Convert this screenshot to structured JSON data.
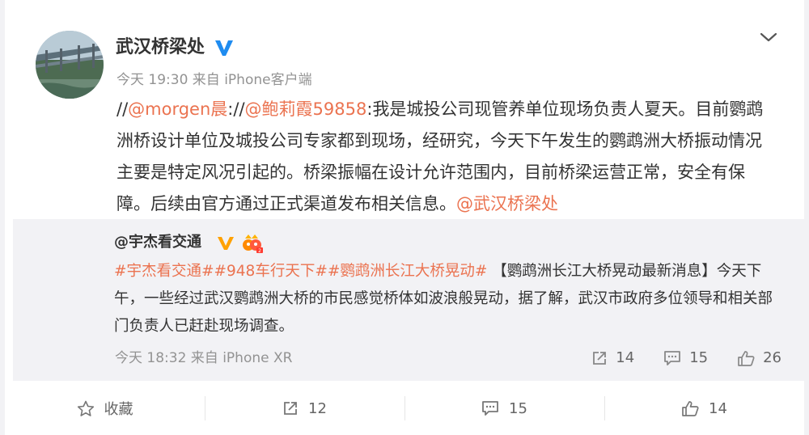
{
  "post": {
    "user_name": "武汉桥梁处",
    "meta": "今天 19:30 来自 iPhone客户端",
    "text": {
      "prefix1": "//",
      "mention1": "@morgen晨",
      "sep": "://",
      "mention2": "@鲍莉霞59858",
      "body": ":我是城投公司现管养单位现场负责人夏天。目前鹦鹉洲桥设计单位及城投公司专家都到现场，经研究，今天下午发生的鹦鹉洲大桥振动情况主要是特定风况引起的。桥梁振幅在设计允许范围内，目前桥梁运营正常，安全有保障。后续由官方通过正式渠道发布相关信息。",
      "mention3": "@武汉桥梁处"
    }
  },
  "repost": {
    "user": "@宇杰看交通",
    "topics": [
      "#宇杰看交通#",
      "#948车行天下#",
      "#鹦鹉洲长江大桥晃动#"
    ],
    "body": "【鹦鹉洲长江大桥晃动最新消息】今天下午，一些经过武汉鹦鹉洲大桥的市民感觉桥体如波浪般晃动，据了解，武汉市政府多位领导和相关部门负责人已赶赴现场调查。",
    "meta": "今天 18:32 来自 iPhone XR",
    "stats": {
      "reposts": "14",
      "comments": "15",
      "likes": "26"
    }
  },
  "footer": {
    "favorite_label": "收藏",
    "repost_count": "12",
    "comment_count": "15",
    "like_count": "14"
  },
  "icons": [
    "verified-icon",
    "chevron-down-icon",
    "repost-icon",
    "comment-icon",
    "like-icon",
    "star-icon"
  ],
  "colors": {
    "accent": "#eb7350",
    "verified": "#ffa100",
    "blue_badge": "#1f8cf0"
  }
}
